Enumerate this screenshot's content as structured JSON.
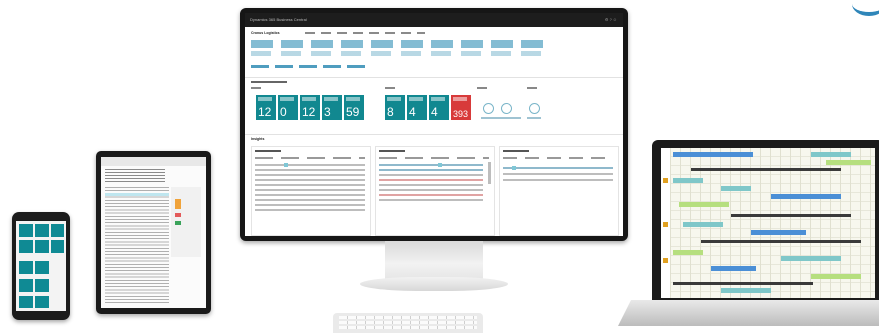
{
  "monitor_app": {
    "window_title": "Dynamics 365 Business Central",
    "company": "Cronus Logistics",
    "tile_values": [
      "12",
      "0",
      "12",
      "3",
      "59",
      "8",
      "4",
      "4",
      "393"
    ],
    "section_title": "Insights"
  },
  "colors": {
    "tile_teal": "#118890",
    "tile_red": "#d83a3a",
    "accent_blue": "#2f86b9",
    "device_black": "#1a1a1a"
  }
}
